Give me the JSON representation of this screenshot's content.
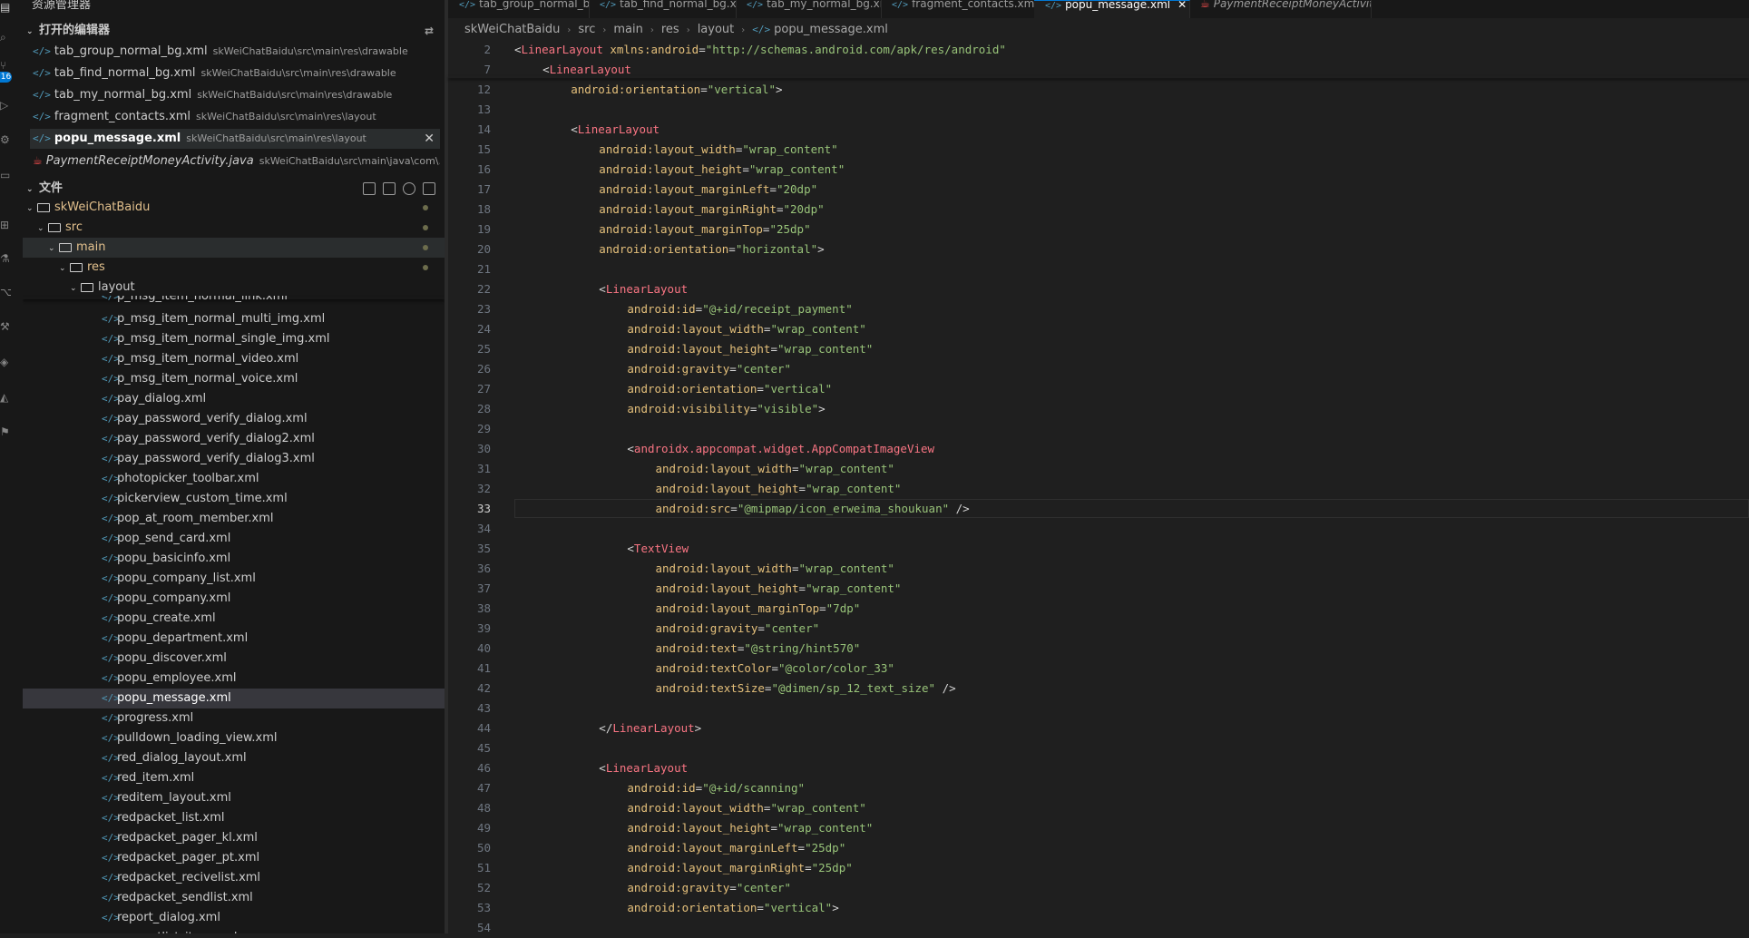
{
  "sidebar": {
    "title": "资源管理器",
    "more": "···",
    "open_editors": {
      "heading": "打开的编辑器",
      "items": [
        {
          "name": "tab_group_normal_bg.xml",
          "path": "skWeiChatBaidu\\src\\main\\res\\drawable",
          "type": "xml"
        },
        {
          "name": "tab_find_normal_bg.xml",
          "path": "skWeiChatBaidu\\src\\main\\res\\drawable",
          "type": "xml"
        },
        {
          "name": "tab_my_normal_bg.xml",
          "path": "skWeiChatBaidu\\src\\main\\res\\drawable",
          "type": "xml"
        },
        {
          "name": "fragment_contacts.xml",
          "path": "skWeiChatBaidu\\src\\main\\res\\layout",
          "type": "xml"
        },
        {
          "name": "popu_message.xml",
          "path": "skWeiChatBaidu\\src\\main\\res\\layout",
          "type": "xml",
          "active": true
        },
        {
          "name": "PaymentReceiptMoneyActivity.java",
          "path": "skWeiChatBaidu\\src\\main\\java\\com\\...",
          "type": "java"
        }
      ]
    },
    "files": {
      "heading": "文件",
      "tree": [
        {
          "name": "skWeiChatBaidu",
          "depth": 0
        },
        {
          "name": "src",
          "depth": 1
        },
        {
          "name": "main",
          "depth": 2
        },
        {
          "name": "res",
          "depth": 3
        },
        {
          "name": "layout",
          "depth": 4
        }
      ],
      "items": [
        "p_msg_item_normal_link.xml",
        "p_msg_item_normal_multi_img.xml",
        "p_msg_item_normal_single_img.xml",
        "p_msg_item_normal_video.xml",
        "p_msg_item_normal_voice.xml",
        "pay_dialog.xml",
        "pay_password_verify_dialog.xml",
        "pay_password_verify_dialog2.xml",
        "pay_password_verify_dialog3.xml",
        "photopicker_toolbar.xml",
        "pickerview_custom_time.xml",
        "pop_at_room_member.xml",
        "pop_send_card.xml",
        "popu_basicinfo.xml",
        "popu_company_list.xml",
        "popu_company.xml",
        "popu_create.xml",
        "popu_department.xml",
        "popu_discover.xml",
        "popu_employee.xml",
        "popu_message.xml",
        "progress.xml",
        "pulldown_loading_view.xml",
        "red_dialog_layout.xml",
        "red_item.xml",
        "reditem_layout.xml",
        "redpacket_list.xml",
        "redpacket_pager_kl.xml",
        "redpacket_pager_pt.xml",
        "redpacket_recivelist.xml",
        "redpacket_sendlist.xml",
        "report_dialog.xml",
        "requestlist_item.xml"
      ],
      "selected": "popu_message.xml"
    }
  },
  "activity": {
    "badge": "16"
  },
  "tabs": [
    {
      "label": "tab_group_normal_bg.xml",
      "type": "xml"
    },
    {
      "label": "tab_find_normal_bg.xml",
      "type": "xml"
    },
    {
      "label": "tab_my_normal_bg.xml",
      "type": "xml"
    },
    {
      "label": "fragment_contacts.xml",
      "type": "xml"
    },
    {
      "label": "popu_message.xml",
      "type": "xml",
      "active": true
    },
    {
      "label": "PaymentReceiptMoneyActivity.java",
      "type": "java"
    }
  ],
  "tab_close": "✕",
  "breadcrumb": [
    "skWeiChatBaidu",
    "src",
    "main",
    "res",
    "layout",
    "popu_message.xml"
  ],
  "code_lines": [
    {
      "n": "2",
      "indent": 0,
      "sticky": true,
      "t": [
        [
          "br",
          "<"
        ],
        [
          "tag",
          "LinearLayout"
        ],
        [
          "txt",
          " "
        ],
        [
          "attr",
          "xmlns:android"
        ],
        [
          "br",
          "="
        ],
        [
          "val",
          "\"http://schemas.android.com/apk/res/android\""
        ]
      ]
    },
    {
      "n": "7",
      "indent": 1,
      "sticky": true,
      "t": [
        [
          "br",
          "<"
        ],
        [
          "tag",
          "LinearLayout"
        ]
      ]
    },
    {
      "n": "12",
      "indent": 2,
      "t": [
        [
          "attr",
          "android:orientation"
        ],
        [
          "br",
          "="
        ],
        [
          "val",
          "\"vertical\""
        ],
        [
          "br",
          ">"
        ]
      ]
    },
    {
      "n": "13",
      "indent": 0,
      "t": []
    },
    {
      "n": "14",
      "indent": 2,
      "t": [
        [
          "br",
          "<"
        ],
        [
          "tag",
          "LinearLayout"
        ]
      ]
    },
    {
      "n": "15",
      "indent": 3,
      "t": [
        [
          "attr",
          "android:layout_width"
        ],
        [
          "br",
          "="
        ],
        [
          "val",
          "\"wrap_content\""
        ]
      ]
    },
    {
      "n": "16",
      "indent": 3,
      "t": [
        [
          "attr",
          "android:layout_height"
        ],
        [
          "br",
          "="
        ],
        [
          "val",
          "\"wrap_content\""
        ]
      ]
    },
    {
      "n": "17",
      "indent": 3,
      "t": [
        [
          "attr",
          "android:layout_marginLeft"
        ],
        [
          "br",
          "="
        ],
        [
          "val",
          "\"20dp\""
        ]
      ]
    },
    {
      "n": "18",
      "indent": 3,
      "t": [
        [
          "attr",
          "android:layout_marginRight"
        ],
        [
          "br",
          "="
        ],
        [
          "val",
          "\"20dp\""
        ]
      ]
    },
    {
      "n": "19",
      "indent": 3,
      "t": [
        [
          "attr",
          "android:layout_marginTop"
        ],
        [
          "br",
          "="
        ],
        [
          "val",
          "\"25dp\""
        ]
      ]
    },
    {
      "n": "20",
      "indent": 3,
      "t": [
        [
          "attr",
          "android:orientation"
        ],
        [
          "br",
          "="
        ],
        [
          "val",
          "\"horizontal\""
        ],
        [
          "br",
          ">"
        ]
      ]
    },
    {
      "n": "21",
      "indent": 0,
      "t": []
    },
    {
      "n": "22",
      "indent": 3,
      "t": [
        [
          "br",
          "<"
        ],
        [
          "tag",
          "LinearLayout"
        ]
      ]
    },
    {
      "n": "23",
      "indent": 4,
      "t": [
        [
          "attr",
          "android:id"
        ],
        [
          "br",
          "="
        ],
        [
          "val",
          "\"@+id/receipt_payment\""
        ]
      ]
    },
    {
      "n": "24",
      "indent": 4,
      "t": [
        [
          "attr",
          "android:layout_width"
        ],
        [
          "br",
          "="
        ],
        [
          "val",
          "\"wrap_content\""
        ]
      ]
    },
    {
      "n": "25",
      "indent": 4,
      "t": [
        [
          "attr",
          "android:layout_height"
        ],
        [
          "br",
          "="
        ],
        [
          "val",
          "\"wrap_content\""
        ]
      ]
    },
    {
      "n": "26",
      "indent": 4,
      "t": [
        [
          "attr",
          "android:gravity"
        ],
        [
          "br",
          "="
        ],
        [
          "val",
          "\"center\""
        ]
      ]
    },
    {
      "n": "27",
      "indent": 4,
      "t": [
        [
          "attr",
          "android:orientation"
        ],
        [
          "br",
          "="
        ],
        [
          "val",
          "\"vertical\""
        ]
      ]
    },
    {
      "n": "28",
      "indent": 4,
      "t": [
        [
          "attr",
          "android:visibility"
        ],
        [
          "br",
          "="
        ],
        [
          "val",
          "\"visible\""
        ],
        [
          "br",
          ">"
        ]
      ]
    },
    {
      "n": "29",
      "indent": 0,
      "t": []
    },
    {
      "n": "30",
      "indent": 4,
      "t": [
        [
          "br",
          "<"
        ],
        [
          "tag",
          "androidx.appcompat.widget.AppCompatImageView"
        ]
      ]
    },
    {
      "n": "31",
      "indent": 5,
      "t": [
        [
          "attr",
          "android:layout_width"
        ],
        [
          "br",
          "="
        ],
        [
          "val",
          "\"wrap_content\""
        ]
      ]
    },
    {
      "n": "32",
      "indent": 5,
      "t": [
        [
          "attr",
          "android:layout_height"
        ],
        [
          "br",
          "="
        ],
        [
          "val",
          "\"wrap_content\""
        ]
      ]
    },
    {
      "n": "33",
      "indent": 5,
      "current": true,
      "t": [
        [
          "attr",
          "android:src"
        ],
        [
          "br",
          "="
        ],
        [
          "val",
          "\"@mipmap/icon_erweima_shoukuan\""
        ],
        [
          "txt",
          " "
        ],
        [
          "br",
          "/>"
        ]
      ]
    },
    {
      "n": "34",
      "indent": 0,
      "t": []
    },
    {
      "n": "35",
      "indent": 4,
      "t": [
        [
          "br",
          "<"
        ],
        [
          "tag",
          "TextView"
        ]
      ]
    },
    {
      "n": "36",
      "indent": 5,
      "t": [
        [
          "attr",
          "android:layout_width"
        ],
        [
          "br",
          "="
        ],
        [
          "val",
          "\"wrap_content\""
        ]
      ]
    },
    {
      "n": "37",
      "indent": 5,
      "t": [
        [
          "attr",
          "android:layout_height"
        ],
        [
          "br",
          "="
        ],
        [
          "val",
          "\"wrap_content\""
        ]
      ]
    },
    {
      "n": "38",
      "indent": 5,
      "t": [
        [
          "attr",
          "android:layout_marginTop"
        ],
        [
          "br",
          "="
        ],
        [
          "val",
          "\"7dp\""
        ]
      ]
    },
    {
      "n": "39",
      "indent": 5,
      "t": [
        [
          "attr",
          "android:gravity"
        ],
        [
          "br",
          "="
        ],
        [
          "val",
          "\"center\""
        ]
      ]
    },
    {
      "n": "40",
      "indent": 5,
      "t": [
        [
          "attr",
          "android:text"
        ],
        [
          "br",
          "="
        ],
        [
          "val",
          "\"@string/hint570\""
        ]
      ]
    },
    {
      "n": "41",
      "indent": 5,
      "t": [
        [
          "attr",
          "android:textColor"
        ],
        [
          "br",
          "="
        ],
        [
          "val",
          "\"@color/color_33\""
        ]
      ]
    },
    {
      "n": "42",
      "indent": 5,
      "t": [
        [
          "attr",
          "android:textSize"
        ],
        [
          "br",
          "="
        ],
        [
          "val",
          "\"@dimen/sp_12_text_size\""
        ],
        [
          "txt",
          " "
        ],
        [
          "br",
          "/>"
        ]
      ]
    },
    {
      "n": "43",
      "indent": 0,
      "t": []
    },
    {
      "n": "44",
      "indent": 3,
      "t": [
        [
          "br",
          "</"
        ],
        [
          "tag",
          "LinearLayout"
        ],
        [
          "br",
          ">"
        ]
      ]
    },
    {
      "n": "45",
      "indent": 0,
      "t": []
    },
    {
      "n": "46",
      "indent": 3,
      "t": [
        [
          "br",
          "<"
        ],
        [
          "tag",
          "LinearLayout"
        ]
      ]
    },
    {
      "n": "47",
      "indent": 4,
      "t": [
        [
          "attr",
          "android:id"
        ],
        [
          "br",
          "="
        ],
        [
          "val",
          "\"@+id/scanning\""
        ]
      ]
    },
    {
      "n": "48",
      "indent": 4,
      "t": [
        [
          "attr",
          "android:layout_width"
        ],
        [
          "br",
          "="
        ],
        [
          "val",
          "\"wrap_content\""
        ]
      ]
    },
    {
      "n": "49",
      "indent": 4,
      "t": [
        [
          "attr",
          "android:layout_height"
        ],
        [
          "br",
          "="
        ],
        [
          "val",
          "\"wrap_content\""
        ]
      ]
    },
    {
      "n": "50",
      "indent": 4,
      "t": [
        [
          "attr",
          "android:layout_marginLeft"
        ],
        [
          "br",
          "="
        ],
        [
          "val",
          "\"25dp\""
        ]
      ]
    },
    {
      "n": "51",
      "indent": 4,
      "t": [
        [
          "attr",
          "android:layout_marginRight"
        ],
        [
          "br",
          "="
        ],
        [
          "val",
          "\"25dp\""
        ]
      ]
    },
    {
      "n": "52",
      "indent": 4,
      "t": [
        [
          "attr",
          "android:gravity"
        ],
        [
          "br",
          "="
        ],
        [
          "val",
          "\"center\""
        ]
      ]
    },
    {
      "n": "53",
      "indent": 4,
      "t": [
        [
          "attr",
          "android:orientation"
        ],
        [
          "br",
          "="
        ],
        [
          "val",
          "\"vertical\""
        ],
        [
          "br",
          ">"
        ]
      ]
    },
    {
      "n": "54",
      "indent": 0,
      "t": []
    }
  ]
}
